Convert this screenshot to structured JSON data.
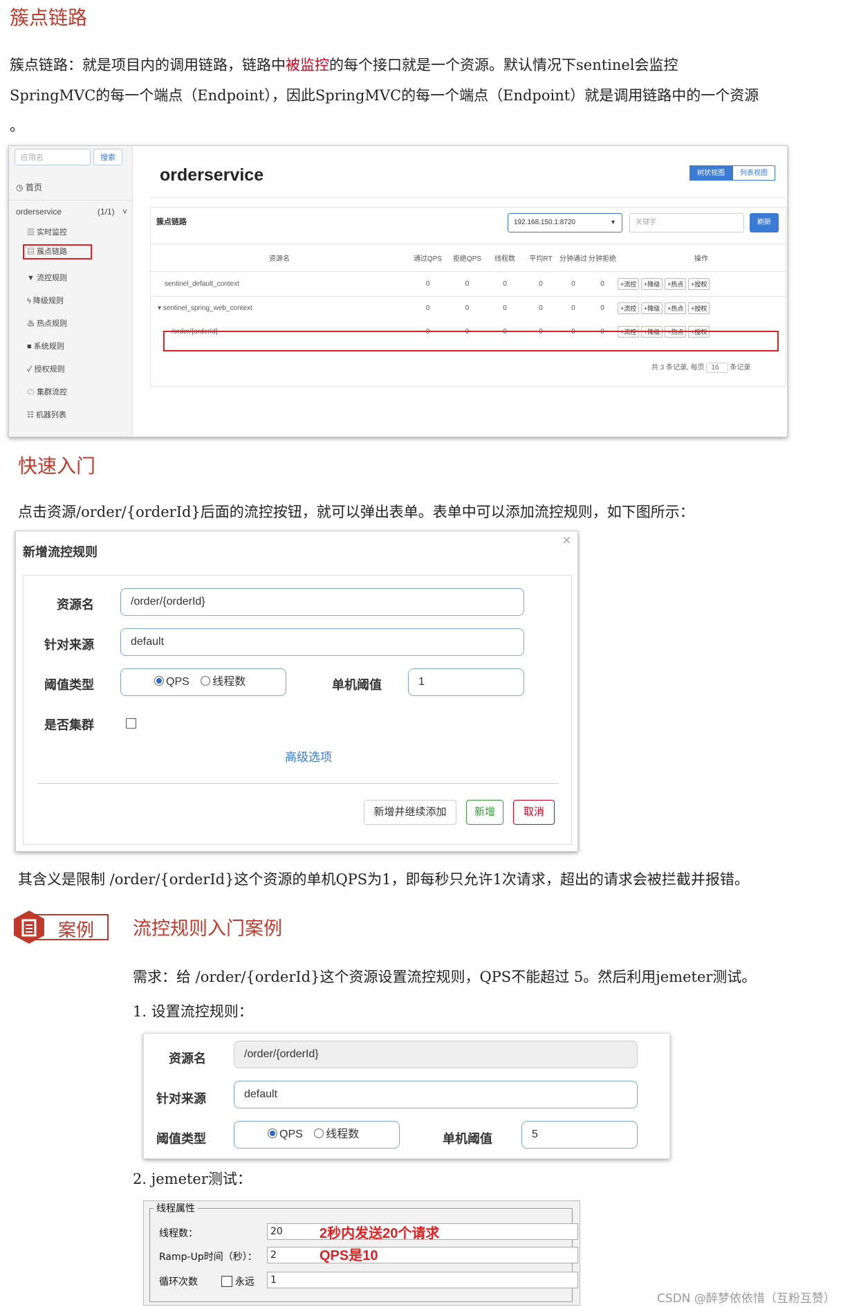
{
  "section1": {
    "heading": "簇点链路",
    "para_line1_a": "簇点链路：就是项目内的调用链路，链路中",
    "para_line1_red": "被监控",
    "para_line1_b": "的每个接口就是一个资源。默认情况下sentinel会监控",
    "para_line2": "SpringMVC的每一个端点（Endpoint），因此SpringMVC的每一个端点（Endpoint）就是调用链路中的一个资源",
    "para_line3": "。"
  },
  "sentinel": {
    "search_placeholder": "应用名",
    "search_button": "搜索",
    "home": "首页",
    "app_name": "orderservice",
    "app_count": "(1/1)",
    "menu": [
      "实时监控",
      "簇点链路",
      "流控规则",
      "降级规则",
      "热点规则",
      "系统规则",
      "授权规则",
      "集群流控",
      "机器列表"
    ],
    "title": "orderservice",
    "view_tree": "树状视图",
    "view_list": "列表视图",
    "panel_title": "簇点链路",
    "machine": "192.168.150.1:8720",
    "keyword_placeholder": "关键字",
    "refresh": "刷新",
    "columns": [
      "资源名",
      "通过QPS",
      "拒绝QPS",
      "线程数",
      "平均RT",
      "分钟通过",
      "分钟拒绝",
      "操作"
    ],
    "rows": [
      {
        "name": "sentinel_default_context",
        "vals": [
          "0",
          "0",
          "0",
          "0",
          "0",
          "0"
        ]
      },
      {
        "name": "sentinel_spring_web_context",
        "vals": [
          "0",
          "0",
          "0",
          "0",
          "0",
          "0"
        ]
      },
      {
        "name": "/order/{orderId}",
        "vals": [
          "0",
          "0",
          "0",
          "0",
          "0",
          "0"
        ]
      }
    ],
    "ops": [
      "+流控",
      "+降级",
      "+热点",
      "+授权"
    ],
    "footer_a": "共 3 条记录, 每页",
    "page_size": "16",
    "footer_b": "条记录"
  },
  "section2": {
    "heading": "快速入门",
    "para": "点击资源/order/{orderId}后面的流控按钮，就可以弹出表单。表单中可以添加流控规则，如下图所示："
  },
  "dialog": {
    "title": "新增流控规则",
    "close": "×",
    "resource_label": "资源名",
    "resource_value": "/order/{orderId}",
    "source_label": "针对来源",
    "source_value": "default",
    "threshold_type_label": "阈值类型",
    "opt_qps": "QPS",
    "opt_thread": "线程数",
    "single_threshold_label": "单机阈值",
    "single_threshold_value": "1",
    "cluster_label": "是否集群",
    "advanced": "高级选项",
    "btn_add_continue": "新增并继续添加",
    "btn_add": "新增",
    "btn_cancel": "取消"
  },
  "section3": {
    "para": "其含义是限制 /order/{orderId}这个资源的单机QPS为1，即每秒只允许1次请求，超出的请求会被拦截并报错。",
    "case_tag": "案例",
    "case_title": "流控规则入门案例",
    "req": "需求：给 /order/{orderId}这个资源设置流控规则，QPS不能超过 5。然后利用jemeter测试。",
    "step1": "1. 设置流控规则：",
    "step2": "2. jemeter测试："
  },
  "rule2": {
    "resource_label": "资源名",
    "resource_value": "/order/{orderId}",
    "source_label": "针对来源",
    "source_value": "default",
    "threshold_type_label": "阈值类型",
    "opt_qps": "QPS",
    "opt_thread": "线程数",
    "single_threshold_label": "单机阈值",
    "single_threshold_value": "5"
  },
  "jmeter": {
    "group": "线程属性",
    "threads_label": "线程数：",
    "threads_value": "20",
    "rampup_label": "Ramp-Up时间（秒）：",
    "rampup_value": "2",
    "loop_label": "循环次数",
    "forever": "永远",
    "loop_value": "1",
    "note1": "2秒内发送20个请求",
    "note2": "QPS是10"
  },
  "watermark": "CSDN @醉梦依依惜（互粉互赞）"
}
